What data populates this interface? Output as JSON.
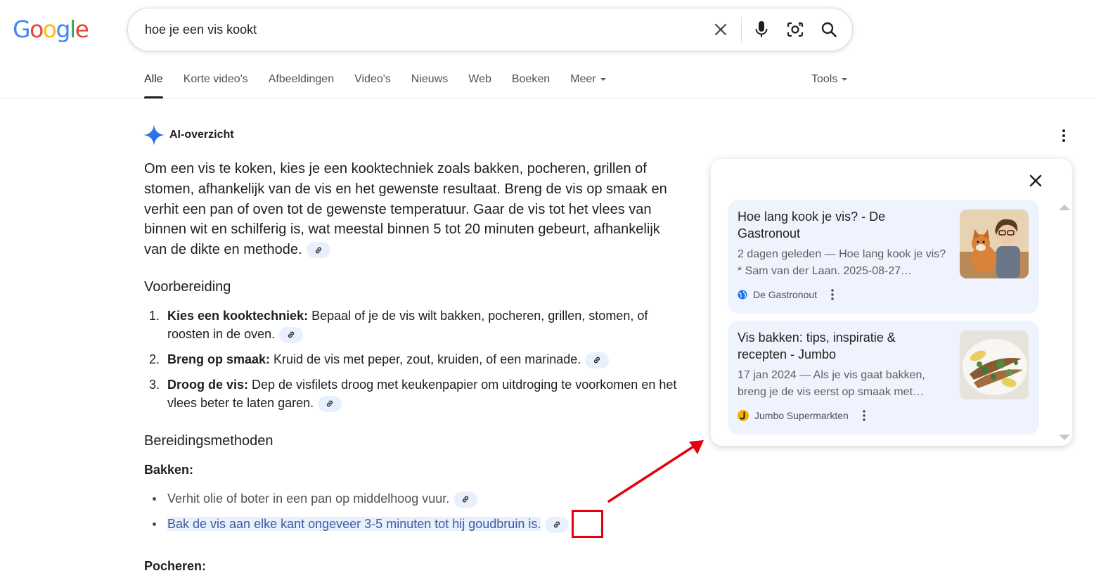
{
  "logo": {
    "letters": [
      "G",
      "o",
      "o",
      "g",
      "l",
      "e"
    ],
    "colors": [
      "#4285f4",
      "#ea4335",
      "#fbbc05",
      "#4285f4",
      "#34a853",
      "#ea4335"
    ]
  },
  "search": {
    "query": "hoe je een vis kookt",
    "clear_icon": "close-icon",
    "voice_icon": "microphone-icon",
    "lens_icon": "camera-lens-icon",
    "search_icon": "search-icon"
  },
  "tabs": [
    {
      "label": "Alle",
      "active": true
    },
    {
      "label": "Korte video's"
    },
    {
      "label": "Afbeeldingen"
    },
    {
      "label": "Video's"
    },
    {
      "label": "Nieuws"
    },
    {
      "label": "Web"
    },
    {
      "label": "Boeken"
    },
    {
      "label": "Meer"
    }
  ],
  "tools_label": "Tools",
  "ai_overview": {
    "title": "AI-overzicht",
    "summary": "Om een vis te koken, kies je een kooktechniek zoals bakken, pocheren, grillen of stomen, afhankelijk van de vis en het gewenste resultaat. Breng de vis op smaak en verhit een pan of oven tot de gewenste temperatuur. Gaar de vis tot het vlees van binnen wit en schilferig is, wat meestal binnen 5 tot 20 minuten gebeurt, afhankelijk van de dikte en methode.",
    "prep_heading": "Voorbereiding",
    "prep_steps": [
      {
        "num": "1.",
        "bold": "Kies een kooktechniek:",
        "text": " Bepaal of je de vis wilt bakken, pocheren, grillen, stomen, of roosten in de oven."
      },
      {
        "num": "2.",
        "bold": "Breng op smaak:",
        "text": " Kruid de vis met peper, zout, kruiden, of een marinade."
      },
      {
        "num": "3.",
        "bold": "Droog de vis:",
        "text": " Dep de visfilets droog met keukenpapier om uitdroging te voorkomen en het vlees beter te laten garen."
      }
    ],
    "methods_heading": "Bereidingsmethoden",
    "bakken_label": "Bakken:",
    "bakken_items": [
      "Verhit olie of boter in een pan op middelhoog vuur.",
      "Bak de vis aan elke kant ongeveer 3-5 minuten tot hij goudbruin is."
    ],
    "pocheren_label": "Pocheren:"
  },
  "sources": [
    {
      "title": "Hoe lang kook je vis? - De Gastronout",
      "snippet": "2 dagen geleden — Hoe lang kook je vis? * Sam van der Laan. 2025-08-27…",
      "source": "De Gastronout",
      "favicon": "globe-icon"
    },
    {
      "title": "Vis bakken: tips, inspiratie & recepten - Jumbo",
      "snippet": "17 jan 2024 — Als je vis gaat bakken, breng je de vis eerst op smaak met…",
      "source": "Jumbo Supermarkten",
      "favicon": "jumbo-logo-icon"
    }
  ],
  "colors": {
    "accent_red": "#e3000f",
    "chip_bg": "#e8f0fe",
    "card_bg": "#eef3fd"
  }
}
